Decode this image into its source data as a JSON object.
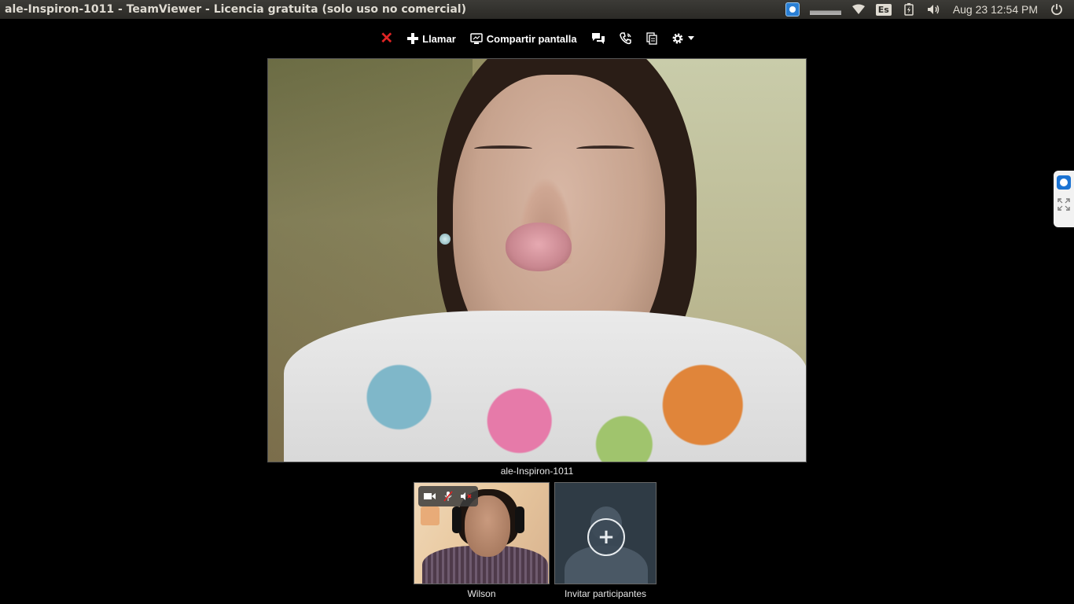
{
  "window": {
    "title": "ale-Inspiron-1011 - TeamViewer - Licencia gratuita (solo uso no comercial)"
  },
  "system_tray": {
    "icons": [
      "teamviewer-tray-icon",
      "system-load-graph",
      "wifi-icon",
      "keyboard-layout-icon",
      "battery-icon",
      "volume-icon",
      "power-icon"
    ],
    "keyboard_layout": "Es",
    "clock": "Aug 23 12:54 PM"
  },
  "toolbar": {
    "close_icon": "close-x-icon",
    "call_label": "Llamar",
    "share_screen_label": "Compartir pantalla",
    "chat_icon": "chat-bubbles-icon",
    "phone_icon": "phone-call-icon",
    "files_icon": "files-icon",
    "settings_icon": "gear-icon"
  },
  "main_video": {
    "participant_name": "ale-Inspiron-1011"
  },
  "participants": [
    {
      "name": "Wilson",
      "media_controls": [
        "camera-icon",
        "microphone-muted-icon",
        "speaker-muted-icon"
      ]
    }
  ],
  "invite": {
    "label": "Invitar participantes"
  },
  "colors": {
    "close_red": "#e02424",
    "panel_bg": "#2b2a26",
    "teamviewer_blue": "#1b73d3",
    "invite_bg": "#2f3b45"
  }
}
